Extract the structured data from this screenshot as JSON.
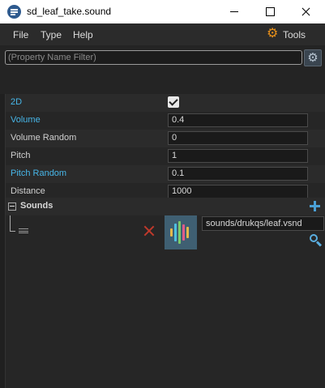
{
  "window": {
    "title": "sd_leaf_take.sound"
  },
  "menu": {
    "file": "File",
    "type": "Type",
    "help": "Help",
    "tools": "Tools"
  },
  "filter": {
    "placeholder": "(Property Name Filter)"
  },
  "properties": [
    {
      "label": "2D",
      "type": "checkbox",
      "checked": true,
      "modified": true
    },
    {
      "label": "Volume",
      "type": "text",
      "value": "0.4",
      "modified": true
    },
    {
      "label": "Volume Random",
      "type": "text",
      "value": "0",
      "modified": false
    },
    {
      "label": "Pitch",
      "type": "text",
      "value": "1",
      "modified": false
    },
    {
      "label": "Pitch Random",
      "type": "text",
      "value": "0.1",
      "modified": true
    },
    {
      "label": "Distance",
      "type": "text",
      "value": "1000",
      "modified": false
    }
  ],
  "sounds": {
    "header": "Sounds",
    "items": [
      {
        "path": "sounds/drukqs/leaf.vsnd"
      }
    ]
  },
  "colors": {
    "modified_label": "#47b6e8",
    "accent_orange": "#e8901a",
    "remove_red": "#c0392b",
    "add_blue": "#4a9fd4"
  },
  "icons": [
    "app-icon",
    "gear-icon",
    "tools-gear-icon",
    "checkbox-checked-icon",
    "collapse-icon",
    "add-icon",
    "drag-handle-icon",
    "remove-icon",
    "sound-thumbnail-icon",
    "browse-icon"
  ]
}
